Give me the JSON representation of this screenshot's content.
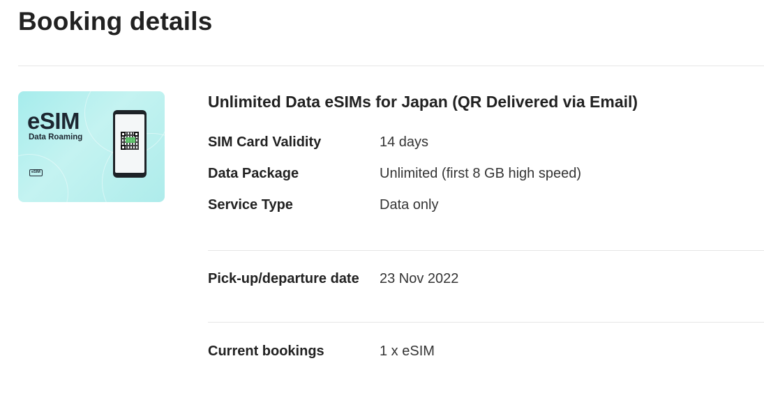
{
  "page": {
    "heading": "Booking details"
  },
  "product": {
    "title": "Unlimited Data eSIMs for Japan (QR Delivered via Email)",
    "image": {
      "title": "eSIM",
      "subtitle": "Data Roaming",
      "badge": "eSIM",
      "background_color": "#aeeceb"
    },
    "details": [
      {
        "label": "SIM Card Validity",
        "value": "14 days"
      },
      {
        "label": "Data Package",
        "value": "Unlimited (first 8 GB high speed)"
      },
      {
        "label": "Service Type",
        "value": "Data only"
      }
    ]
  },
  "booking": {
    "date": {
      "label": "Pick-up/departure date",
      "value": "23 Nov 2022"
    },
    "current": {
      "label": "Current bookings",
      "value": "1 x eSIM"
    }
  },
  "colors": {
    "text_primary": "#212121",
    "text_secondary": "#333333",
    "divider": "#e6e6e6"
  }
}
